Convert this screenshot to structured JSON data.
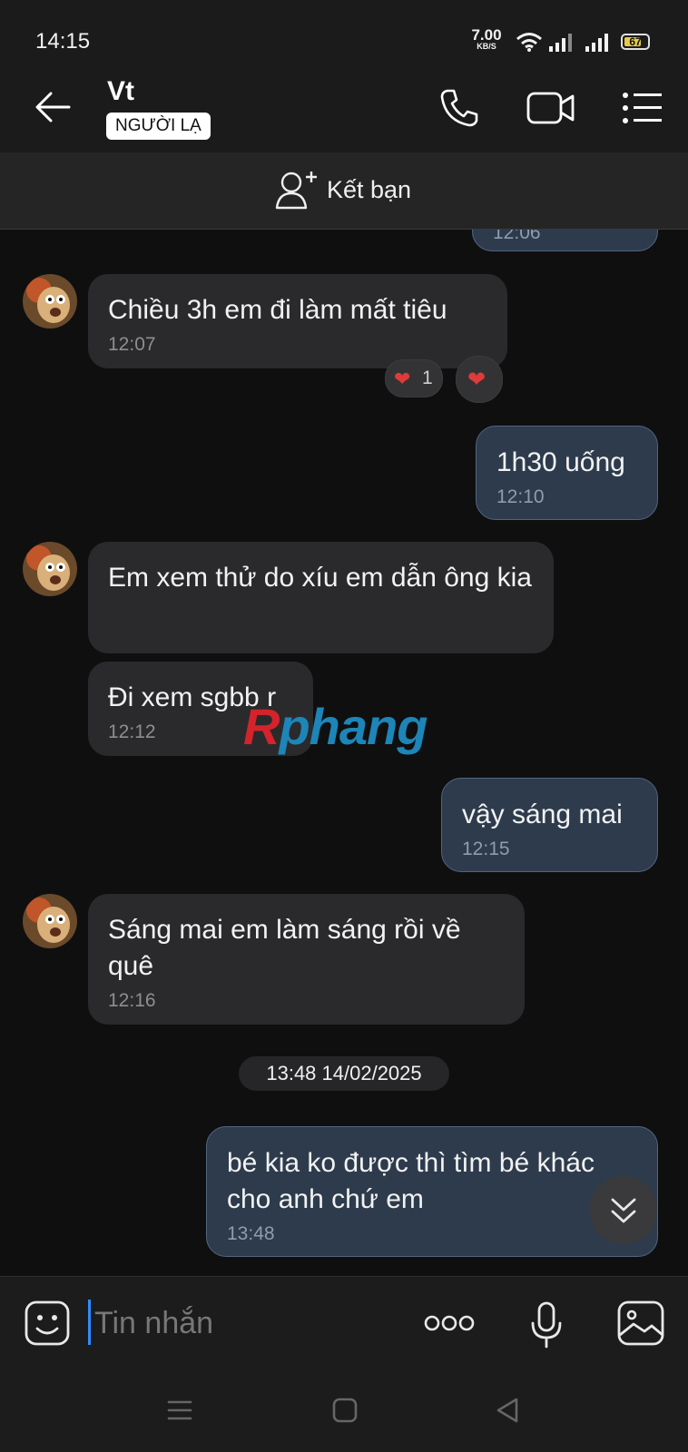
{
  "status_bar": {
    "time": "14:15",
    "net_speed_value": "7.00",
    "net_speed_unit": "KB/S",
    "battery": "67"
  },
  "header": {
    "contact_name": "Vt",
    "stranger_badge": "NGƯỜI LẠ",
    "icons": [
      "back-arrow-icon",
      "phone-icon",
      "video-call-icon",
      "menu-list-icon"
    ]
  },
  "add_friend": {
    "label": "Kết bạn",
    "icon": "add-person-icon"
  },
  "messages": [
    {
      "side": "out",
      "text": "",
      "time": "12:06",
      "partial": true
    },
    {
      "side": "in",
      "text": "Chiều 3h em đi làm mất tiêu",
      "time": "12:07",
      "reactions": {
        "count": "1"
      }
    },
    {
      "side": "out",
      "text": "1h30 uống",
      "time": "12:10"
    },
    {
      "side": "in",
      "text": "Em xem thử do xíu em dẫn ông kia",
      "time": ""
    },
    {
      "side": "in",
      "text": "Đi xem sgbb r",
      "time": "12:12"
    },
    {
      "side": "out",
      "text": "vậy sáng mai",
      "time": "12:15"
    },
    {
      "side": "in",
      "text": "Sáng mai em làm sáng rồi về quê",
      "time": "12:16"
    },
    {
      "side": "out",
      "text": "bé kia ko được thì tìm bé khác cho anh chứ em",
      "time": "13:48"
    }
  ],
  "date_separator": "13:48 14/02/2025",
  "watermark": {
    "part1": "R",
    "part2": "phang"
  },
  "input_bar": {
    "placeholder": "Tin nhắn",
    "icons": [
      "sticker-icon",
      "more-options-icon",
      "microphone-icon",
      "image-gallery-icon"
    ]
  },
  "nav_bar": {
    "icons": [
      "recent-apps-icon",
      "home-icon",
      "back-nav-icon"
    ]
  },
  "colors": {
    "bg": "#0f0f10",
    "incoming_bubble": "#2a2a2c",
    "outgoing_bubble": "#2d3b4d",
    "accent": "#2f8cff"
  }
}
